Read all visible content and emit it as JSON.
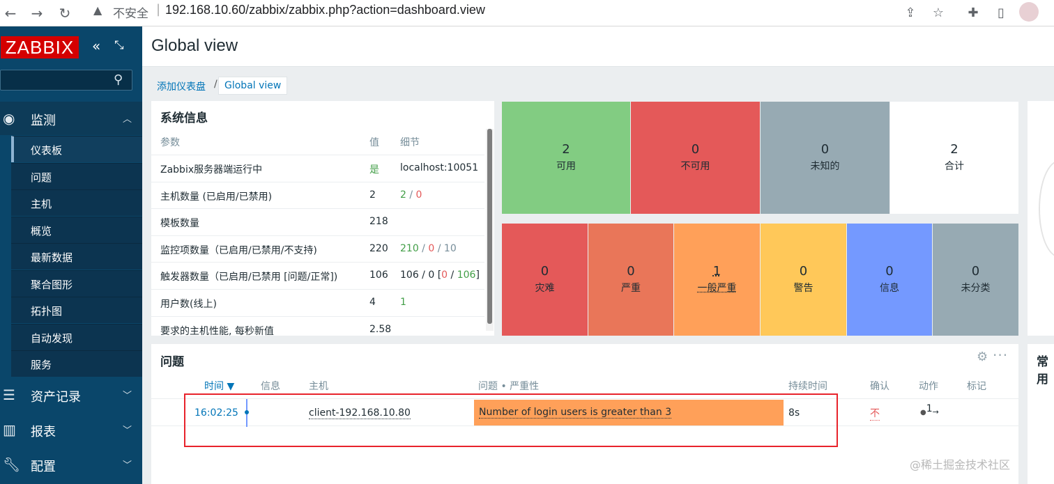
{
  "browser": {
    "insecure_label": "不安全",
    "url": "192.168.10.60/zabbix/zabbix.php?action=dashboard.view"
  },
  "sidebar": {
    "logo": "ZABBIX",
    "menu": [
      {
        "label": "监测",
        "icon": "eye-icon"
      },
      {
        "label": "资产记录",
        "icon": "list-icon"
      },
      {
        "label": "报表",
        "icon": "bar-chart-icon"
      },
      {
        "label": "配置",
        "icon": "wrench-icon"
      }
    ],
    "submenu": [
      "仪表板",
      "问题",
      "主机",
      "概览",
      "最新数据",
      "聚合图形",
      "拓扑图",
      "自动发现",
      "服务"
    ]
  },
  "header": {
    "title": "Global view"
  },
  "breadcrumb": {
    "parent": "添加仪表盘",
    "separator": "/",
    "current": "Global view"
  },
  "system_info": {
    "title": "系统信息",
    "columns": [
      "参数",
      "值",
      "细节"
    ],
    "rows": [
      {
        "param": "Zabbix服务器端运行中",
        "value": "是",
        "detail": "localhost:10051"
      },
      {
        "param": "主机数量 (已启用/已禁用)",
        "value": "2",
        "detail_parts": [
          "2",
          " / ",
          "0"
        ]
      },
      {
        "param": "模板数量",
        "value": "218",
        "detail": ""
      },
      {
        "param": "监控项数量（已启用/已禁用/不支持)",
        "value": "220",
        "detail_parts": [
          "210",
          " / ",
          "0",
          " / ",
          "10"
        ]
      },
      {
        "param": "触发器数量（已启用/已禁用 [问题/正常])",
        "value": "106",
        "detail_parts": [
          "106 / 0 [",
          "0",
          " / ",
          "106",
          "]"
        ]
      },
      {
        "param": "用户数(线上)",
        "value": "4",
        "detail": "1"
      },
      {
        "param": "要求的主机性能, 每秒新值",
        "value": "2.58",
        "detail": ""
      }
    ]
  },
  "host_availability": [
    {
      "count": "2",
      "label": "可用",
      "color": "#82cc82"
    },
    {
      "count": "0",
      "label": "不可用",
      "color": "#e45959"
    },
    {
      "count": "0",
      "label": "未知的",
      "color": "#97aab3"
    },
    {
      "count": "2",
      "label": "合计",
      "color": "#ffffff"
    }
  ],
  "problems_by_severity": [
    {
      "count": "0",
      "label": "灾难",
      "color": "#e45959"
    },
    {
      "count": "0",
      "label": "严重",
      "color": "#e97659"
    },
    {
      "count": "1",
      "label": "一般严重",
      "color": "#ffa059"
    },
    {
      "count": "0",
      "label": "警告",
      "color": "#ffc859"
    },
    {
      "count": "0",
      "label": "信息",
      "color": "#7499ff"
    },
    {
      "count": "0",
      "label": "未分类",
      "color": "#97aab3"
    }
  ],
  "problems": {
    "title": "问题",
    "columns": [
      "时间 ▼",
      "信息",
      "主机",
      "问题 • 严重性",
      "持续时间",
      "确认",
      "动作",
      "标记"
    ],
    "row": {
      "time": "16:02:25",
      "host": "client-192.168.10.80",
      "problem": "Number of login users is greater than 3",
      "duration": "8s",
      "ack": "不",
      "action": "1"
    }
  },
  "favorites": {
    "title": "常用"
  },
  "watermark": "@稀土掘金技术社区"
}
